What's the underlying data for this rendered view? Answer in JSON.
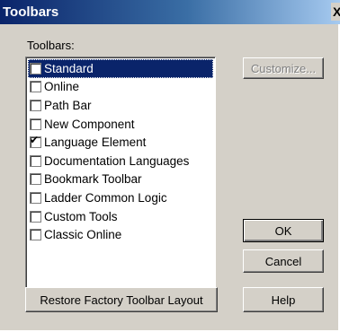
{
  "window": {
    "title": "Toolbars",
    "close_glyph": "X"
  },
  "group_label": "Toolbars:",
  "toolbars": [
    {
      "label": "Standard",
      "checked": false,
      "selected": true
    },
    {
      "label": "Online",
      "checked": false,
      "selected": false
    },
    {
      "label": "Path Bar",
      "checked": false,
      "selected": false
    },
    {
      "label": "New Component",
      "checked": false,
      "selected": false
    },
    {
      "label": "Language Element",
      "checked": true,
      "selected": false
    },
    {
      "label": "Documentation Languages",
      "checked": false,
      "selected": false
    },
    {
      "label": "Bookmark Toolbar",
      "checked": false,
      "selected": false
    },
    {
      "label": "Ladder Common Logic",
      "checked": false,
      "selected": false
    },
    {
      "label": "Custom Tools",
      "checked": false,
      "selected": false
    },
    {
      "label": "Classic Online",
      "checked": false,
      "selected": false
    }
  ],
  "buttons": {
    "customize": "Customize...",
    "ok": "OK",
    "cancel": "Cancel",
    "restore": "Restore Factory Toolbar Layout",
    "help": "Help"
  },
  "colors": {
    "titlebar": "#0a246a",
    "face": "#d4d0c8",
    "selection": "#0a246a"
  }
}
